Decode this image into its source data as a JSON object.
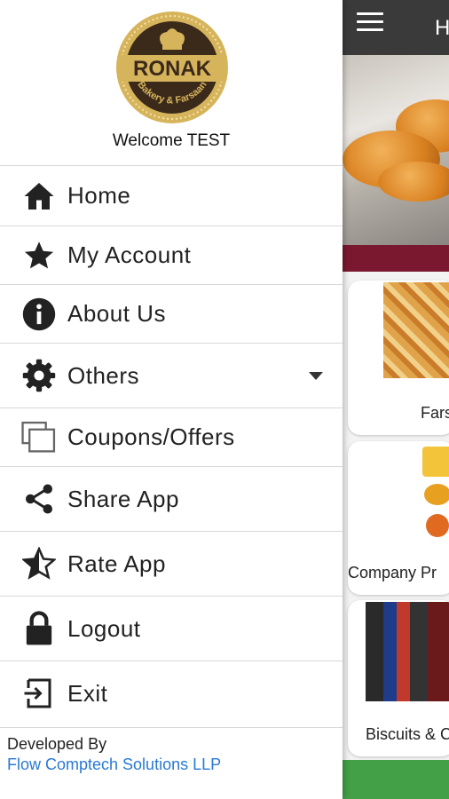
{
  "background_app": {
    "toolbar_title": "H",
    "cards": [
      {
        "label": "Fars"
      },
      {
        "label": "Company Pr"
      },
      {
        "label": "Biscuits & C"
      }
    ]
  },
  "drawer": {
    "logo": {
      "brand": "RONAK",
      "tagline": "Bakery & Farsaan"
    },
    "welcome": "Welcome TEST",
    "menu": [
      {
        "label": "Home",
        "icon": "home-icon"
      },
      {
        "label": "My Account",
        "icon": "star-icon"
      },
      {
        "label": "About Us",
        "icon": "info-icon"
      },
      {
        "label": "Others",
        "icon": "gear-icon"
      },
      {
        "label": "Coupons/Offers",
        "icon": "coupons-icon"
      },
      {
        "label": "Share App",
        "icon": "share-icon"
      },
      {
        "label": "Rate App",
        "icon": "rate-star-icon"
      },
      {
        "label": "Logout",
        "icon": "lock-icon"
      },
      {
        "label": "Exit",
        "icon": "exit-icon"
      }
    ],
    "footer": {
      "developed_by": "Developed By",
      "company": "Flow Comptech Solutions LLP"
    }
  },
  "colors": {
    "brand_gold": "#c8a24a",
    "brand_dark": "#3b2a1a",
    "link_blue": "#2a79d3",
    "toolbar": "#3a3a3a",
    "accent_maroon": "#7a1830",
    "bottom_green": "#43a047"
  }
}
